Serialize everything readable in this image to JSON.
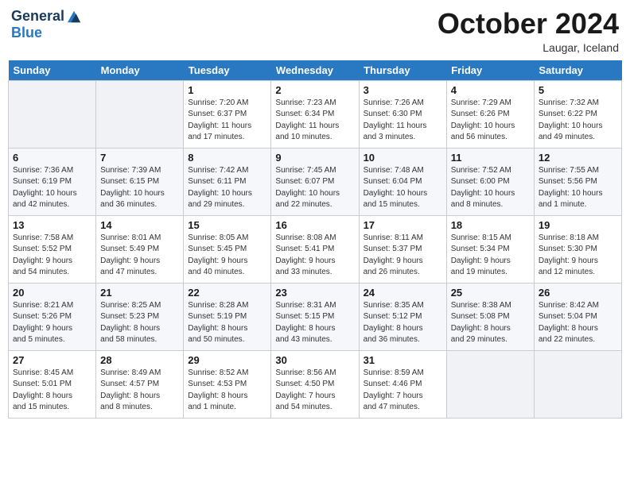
{
  "header": {
    "logo_general": "General",
    "logo_blue": "Blue",
    "month_title": "October 2024",
    "location": "Laugar, Iceland"
  },
  "weekdays": [
    "Sunday",
    "Monday",
    "Tuesday",
    "Wednesday",
    "Thursday",
    "Friday",
    "Saturday"
  ],
  "weeks": [
    [
      {
        "day": "",
        "info": ""
      },
      {
        "day": "",
        "info": ""
      },
      {
        "day": "1",
        "info": "Sunrise: 7:20 AM\nSunset: 6:37 PM\nDaylight: 11 hours\nand 17 minutes."
      },
      {
        "day": "2",
        "info": "Sunrise: 7:23 AM\nSunset: 6:34 PM\nDaylight: 11 hours\nand 10 minutes."
      },
      {
        "day": "3",
        "info": "Sunrise: 7:26 AM\nSunset: 6:30 PM\nDaylight: 11 hours\nand 3 minutes."
      },
      {
        "day": "4",
        "info": "Sunrise: 7:29 AM\nSunset: 6:26 PM\nDaylight: 10 hours\nand 56 minutes."
      },
      {
        "day": "5",
        "info": "Sunrise: 7:32 AM\nSunset: 6:22 PM\nDaylight: 10 hours\nand 49 minutes."
      }
    ],
    [
      {
        "day": "6",
        "info": "Sunrise: 7:36 AM\nSunset: 6:19 PM\nDaylight: 10 hours\nand 42 minutes."
      },
      {
        "day": "7",
        "info": "Sunrise: 7:39 AM\nSunset: 6:15 PM\nDaylight: 10 hours\nand 36 minutes."
      },
      {
        "day": "8",
        "info": "Sunrise: 7:42 AM\nSunset: 6:11 PM\nDaylight: 10 hours\nand 29 minutes."
      },
      {
        "day": "9",
        "info": "Sunrise: 7:45 AM\nSunset: 6:07 PM\nDaylight: 10 hours\nand 22 minutes."
      },
      {
        "day": "10",
        "info": "Sunrise: 7:48 AM\nSunset: 6:04 PM\nDaylight: 10 hours\nand 15 minutes."
      },
      {
        "day": "11",
        "info": "Sunrise: 7:52 AM\nSunset: 6:00 PM\nDaylight: 10 hours\nand 8 minutes."
      },
      {
        "day": "12",
        "info": "Sunrise: 7:55 AM\nSunset: 5:56 PM\nDaylight: 10 hours\nand 1 minute."
      }
    ],
    [
      {
        "day": "13",
        "info": "Sunrise: 7:58 AM\nSunset: 5:52 PM\nDaylight: 9 hours\nand 54 minutes."
      },
      {
        "day": "14",
        "info": "Sunrise: 8:01 AM\nSunset: 5:49 PM\nDaylight: 9 hours\nand 47 minutes."
      },
      {
        "day": "15",
        "info": "Sunrise: 8:05 AM\nSunset: 5:45 PM\nDaylight: 9 hours\nand 40 minutes."
      },
      {
        "day": "16",
        "info": "Sunrise: 8:08 AM\nSunset: 5:41 PM\nDaylight: 9 hours\nand 33 minutes."
      },
      {
        "day": "17",
        "info": "Sunrise: 8:11 AM\nSunset: 5:37 PM\nDaylight: 9 hours\nand 26 minutes."
      },
      {
        "day": "18",
        "info": "Sunrise: 8:15 AM\nSunset: 5:34 PM\nDaylight: 9 hours\nand 19 minutes."
      },
      {
        "day": "19",
        "info": "Sunrise: 8:18 AM\nSunset: 5:30 PM\nDaylight: 9 hours\nand 12 minutes."
      }
    ],
    [
      {
        "day": "20",
        "info": "Sunrise: 8:21 AM\nSunset: 5:26 PM\nDaylight: 9 hours\nand 5 minutes."
      },
      {
        "day": "21",
        "info": "Sunrise: 8:25 AM\nSunset: 5:23 PM\nDaylight: 8 hours\nand 58 minutes."
      },
      {
        "day": "22",
        "info": "Sunrise: 8:28 AM\nSunset: 5:19 PM\nDaylight: 8 hours\nand 50 minutes."
      },
      {
        "day": "23",
        "info": "Sunrise: 8:31 AM\nSunset: 5:15 PM\nDaylight: 8 hours\nand 43 minutes."
      },
      {
        "day": "24",
        "info": "Sunrise: 8:35 AM\nSunset: 5:12 PM\nDaylight: 8 hours\nand 36 minutes."
      },
      {
        "day": "25",
        "info": "Sunrise: 8:38 AM\nSunset: 5:08 PM\nDaylight: 8 hours\nand 29 minutes."
      },
      {
        "day": "26",
        "info": "Sunrise: 8:42 AM\nSunset: 5:04 PM\nDaylight: 8 hours\nand 22 minutes."
      }
    ],
    [
      {
        "day": "27",
        "info": "Sunrise: 8:45 AM\nSunset: 5:01 PM\nDaylight: 8 hours\nand 15 minutes."
      },
      {
        "day": "28",
        "info": "Sunrise: 8:49 AM\nSunset: 4:57 PM\nDaylight: 8 hours\nand 8 minutes."
      },
      {
        "day": "29",
        "info": "Sunrise: 8:52 AM\nSunset: 4:53 PM\nDaylight: 8 hours\nand 1 minute."
      },
      {
        "day": "30",
        "info": "Sunrise: 8:56 AM\nSunset: 4:50 PM\nDaylight: 7 hours\nand 54 minutes."
      },
      {
        "day": "31",
        "info": "Sunrise: 8:59 AM\nSunset: 4:46 PM\nDaylight: 7 hours\nand 47 minutes."
      },
      {
        "day": "",
        "info": ""
      },
      {
        "day": "",
        "info": ""
      }
    ]
  ]
}
